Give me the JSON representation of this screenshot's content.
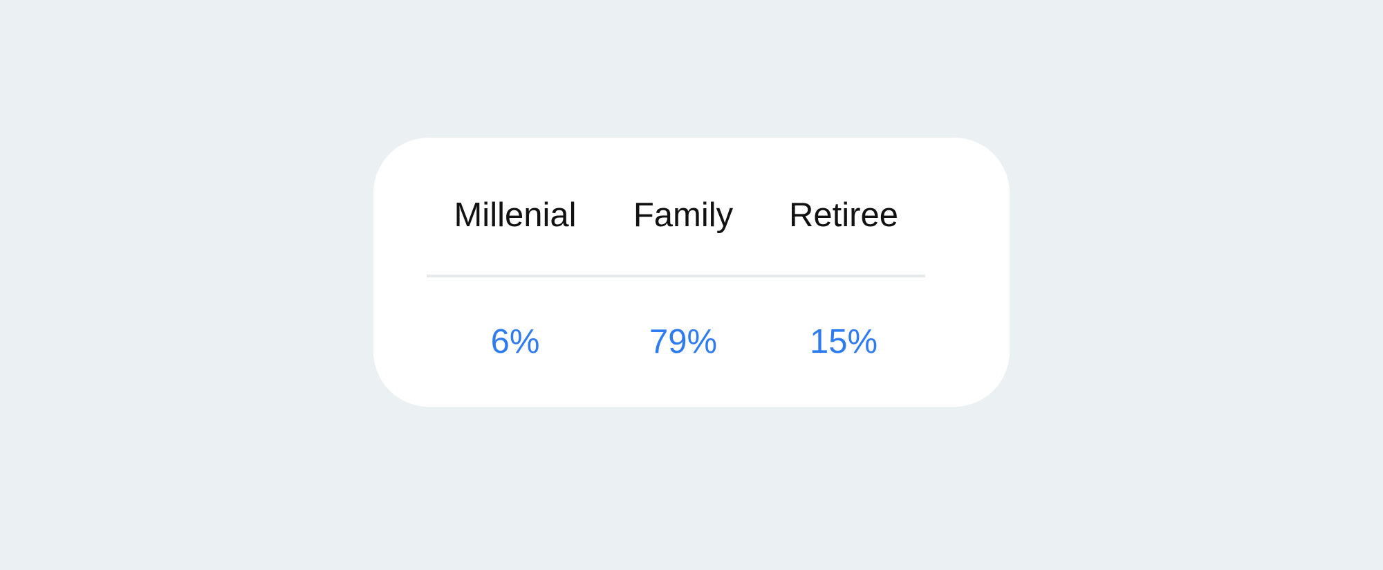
{
  "colors": {
    "background": "#ebf0f2",
    "card": "#ffffff",
    "header_text": "#111111",
    "value_text": "#2f7cf0",
    "divider": "#e5e9eb"
  },
  "table": {
    "headers": [
      "Millenial",
      "Family",
      "Retiree"
    ],
    "values": [
      "6%",
      "79%",
      "15%"
    ]
  }
}
